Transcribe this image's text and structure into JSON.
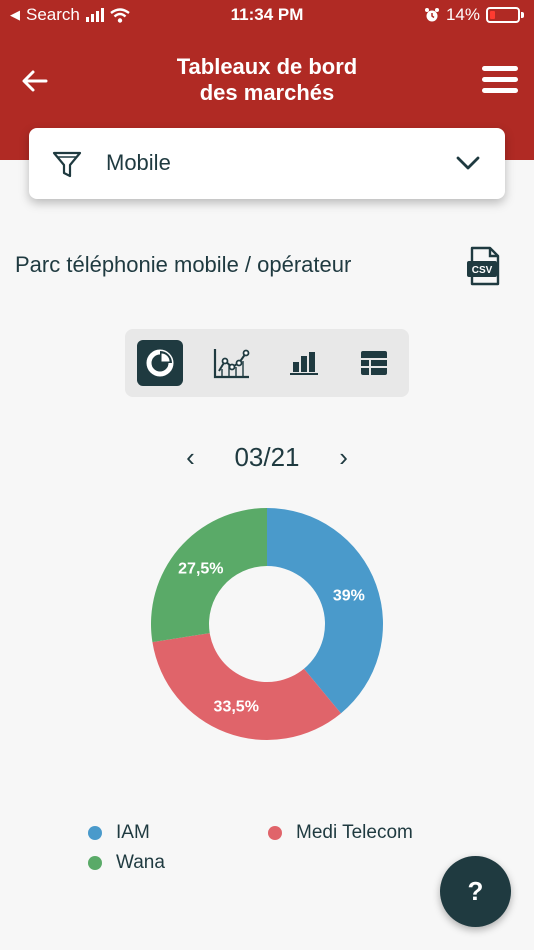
{
  "status_bar": {
    "back_label": "Search",
    "time": "11:34 PM",
    "battery": "14%"
  },
  "header": {
    "title_line1": "Tableaux de bord",
    "title_line2": "des marchés"
  },
  "filter": {
    "selected": "Mobile"
  },
  "section": {
    "title": "Parc téléphonie mobile / opérateur",
    "csv_label": "CSV"
  },
  "view_tabs": [
    "pie-chart-icon",
    "line-chart-icon",
    "bar-chart-icon",
    "table-icon"
  ],
  "pager": {
    "period": "03/21",
    "prev": "‹",
    "next": "›"
  },
  "chart_data": {
    "type": "pie",
    "categories": [
      "IAM",
      "Medi Telecom",
      "Wana"
    ],
    "values": [
      39,
      33.5,
      27.5
    ],
    "labels": [
      "39%",
      "33,5%",
      "27,5%"
    ],
    "colors": [
      "#4a9acb",
      "#e0646a",
      "#5aaa68"
    ],
    "legend_placement": "bottom"
  },
  "legend": [
    {
      "label": "IAM",
      "color": "#4a9acb"
    },
    {
      "label": "Medi Telecom",
      "color": "#e0646a"
    },
    {
      "label": "Wana",
      "color": "#5aaa68"
    }
  ],
  "help": {
    "label": "?"
  },
  "colors": {
    "header": "#b02a24",
    "dark": "#1f3a40"
  }
}
